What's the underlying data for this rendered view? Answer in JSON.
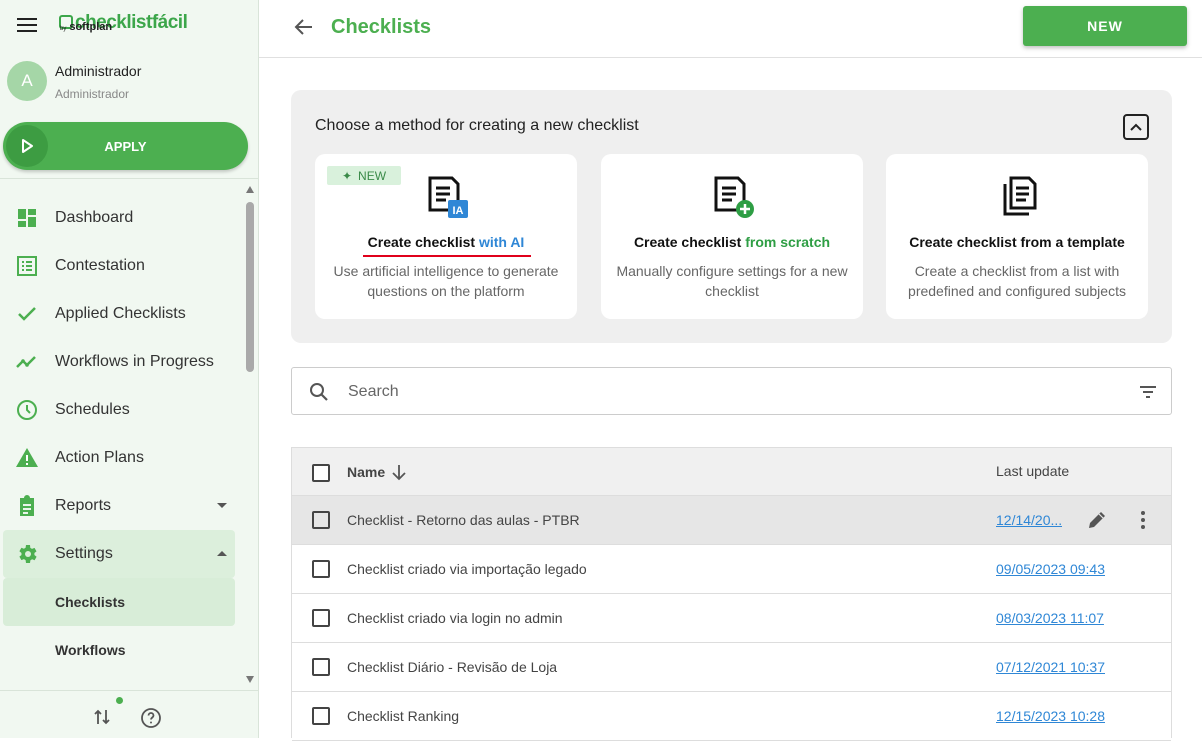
{
  "logo": {
    "main": "checklistfácil",
    "by": "by",
    "brand": "softplan"
  },
  "user": {
    "initial": "A",
    "name": "Administrador",
    "role": "Administrador"
  },
  "sidebar": {
    "apply_label": "APPLY",
    "items": [
      {
        "label": "Dashboard",
        "icon": "dashboard-icon"
      },
      {
        "label": "Contestation",
        "icon": "list-icon"
      },
      {
        "label": "Applied Checklists",
        "icon": "check-icon"
      },
      {
        "label": "Workflows in Progress",
        "icon": "trend-icon"
      },
      {
        "label": "Schedules",
        "icon": "clock-icon"
      },
      {
        "label": "Action Plans",
        "icon": "warning-icon"
      },
      {
        "label": "Reports",
        "icon": "clipboard-icon"
      },
      {
        "label": "Settings",
        "icon": "gear-icon"
      }
    ],
    "subitems": [
      {
        "label": "Checklists"
      },
      {
        "label": "Workflows"
      }
    ]
  },
  "header": {
    "title": "Checklists",
    "new_label": "NEW"
  },
  "methods": {
    "title": "Choose a method for creating a new checklist",
    "cards": [
      {
        "badge": "NEW",
        "title_prefix": "Create checklist ",
        "title_highlight": "with AI",
        "desc": "Use artificial intelligence to generate questions on the platform",
        "icon_tag": "IA"
      },
      {
        "title_prefix": "Create checklist ",
        "title_highlight": "from scratch",
        "desc": "Manually configure settings for a new checklist"
      },
      {
        "title_prefix": "Create checklist from a template",
        "title_highlight": "",
        "desc": "Create a checklist from a list with predefined and configured subjects"
      }
    ]
  },
  "search": {
    "placeholder": "Search"
  },
  "table": {
    "col_name": "Name",
    "col_update": "Last update",
    "rows": [
      {
        "name": "Checklist - Retorno das aulas - PTBR",
        "date": "12/14/20..."
      },
      {
        "name": "Checklist criado via importação legado",
        "date": "09/05/2023 09:43"
      },
      {
        "name": "Checklist criado via login no admin",
        "date": "08/03/2023 11:07"
      },
      {
        "name": "Checklist Diário - Revisão de Loja",
        "date": "07/12/2021 10:37"
      },
      {
        "name": "Checklist Ranking",
        "date": "12/15/2023 10:28"
      }
    ]
  },
  "colors": {
    "brand_green": "#4caf50",
    "link_blue": "#2f87d6",
    "accent_red": "#e0001b"
  }
}
